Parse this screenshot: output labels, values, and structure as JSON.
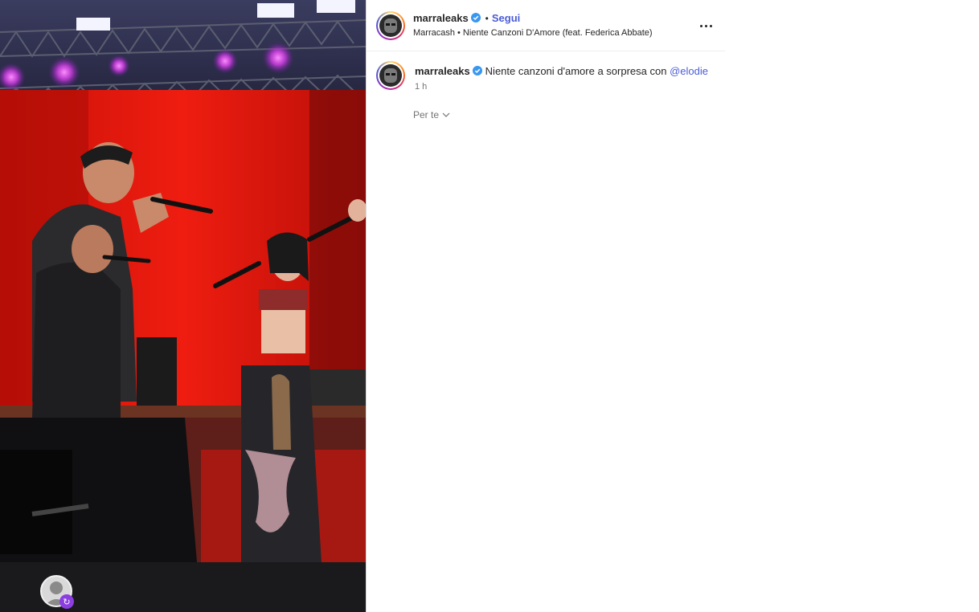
{
  "post": {
    "username": "marraleaks",
    "verified": true,
    "separator": "•",
    "follow_label": "Segui",
    "audio": "Marracash • Niente Canzoni D'Amore (feat. Federica Abbate)",
    "more_icon": "more-horizontal-icon"
  },
  "caption": {
    "username": "marraleaks",
    "text": "Niente canzoni d'amore a sorpresa con",
    "mention": "@elodie",
    "time": "1 h"
  },
  "feed_filter": {
    "label": "Per te",
    "icon": "chevron-down-icon"
  },
  "media": {
    "description_icon": "remix-icon"
  },
  "colors": {
    "link": "#4a5cd6",
    "verified": "#3897f0",
    "stage_red": "#e8190f"
  }
}
